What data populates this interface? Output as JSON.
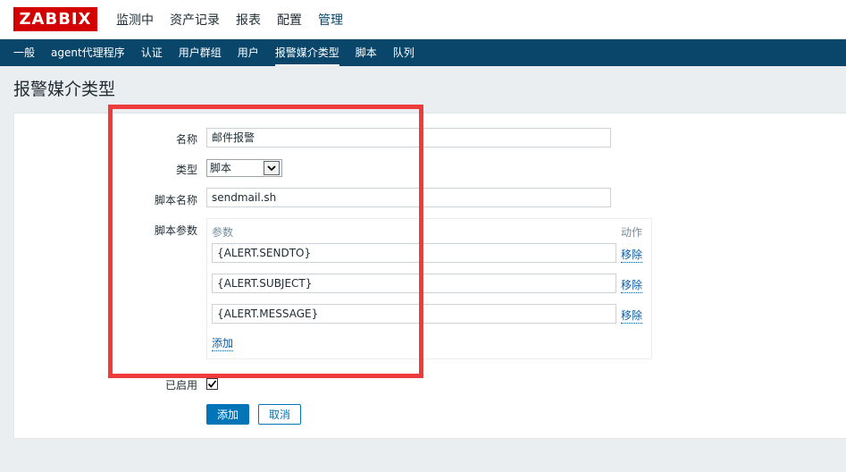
{
  "header": {
    "logo": "ZABBIX",
    "menu": [
      {
        "label": "监测中",
        "active": false
      },
      {
        "label": "资产记录",
        "active": false
      },
      {
        "label": "报表",
        "active": false
      },
      {
        "label": "配置",
        "active": false
      },
      {
        "label": "管理",
        "active": true
      }
    ]
  },
  "subnav": [
    {
      "label": "一般",
      "active": false
    },
    {
      "label": "agent代理程序",
      "active": false
    },
    {
      "label": "认证",
      "active": false
    },
    {
      "label": "用户群组",
      "active": false
    },
    {
      "label": "用户",
      "active": false
    },
    {
      "label": "报警媒介类型",
      "active": true
    },
    {
      "label": "脚本",
      "active": false
    },
    {
      "label": "队列",
      "active": false
    }
  ],
  "page": {
    "title": "报警媒介类型"
  },
  "form": {
    "name_label": "名称",
    "name_value": "邮件报警",
    "type_label": "类型",
    "type_value": "脚本",
    "script_name_label": "脚本名称",
    "script_name_value": "sendmail.sh",
    "script_params_label": "脚本参数",
    "params_header": "参数",
    "action_header": "动作",
    "params": [
      {
        "value": "{ALERT.SENDTO}",
        "remove_label": "移除"
      },
      {
        "value": "{ALERT.SUBJECT}",
        "remove_label": "移除"
      },
      {
        "value": "{ALERT.MESSAGE}",
        "remove_label": "移除"
      }
    ],
    "add_param_label": "添加",
    "enabled_label": "已启用",
    "enabled": true,
    "submit_label": "添加",
    "cancel_label": "取消"
  },
  "colors": {
    "brand": "#d40000",
    "subnav_bg": "#0a466a",
    "primary_button": "#0275b8",
    "annotation": "#ef3b3b"
  }
}
